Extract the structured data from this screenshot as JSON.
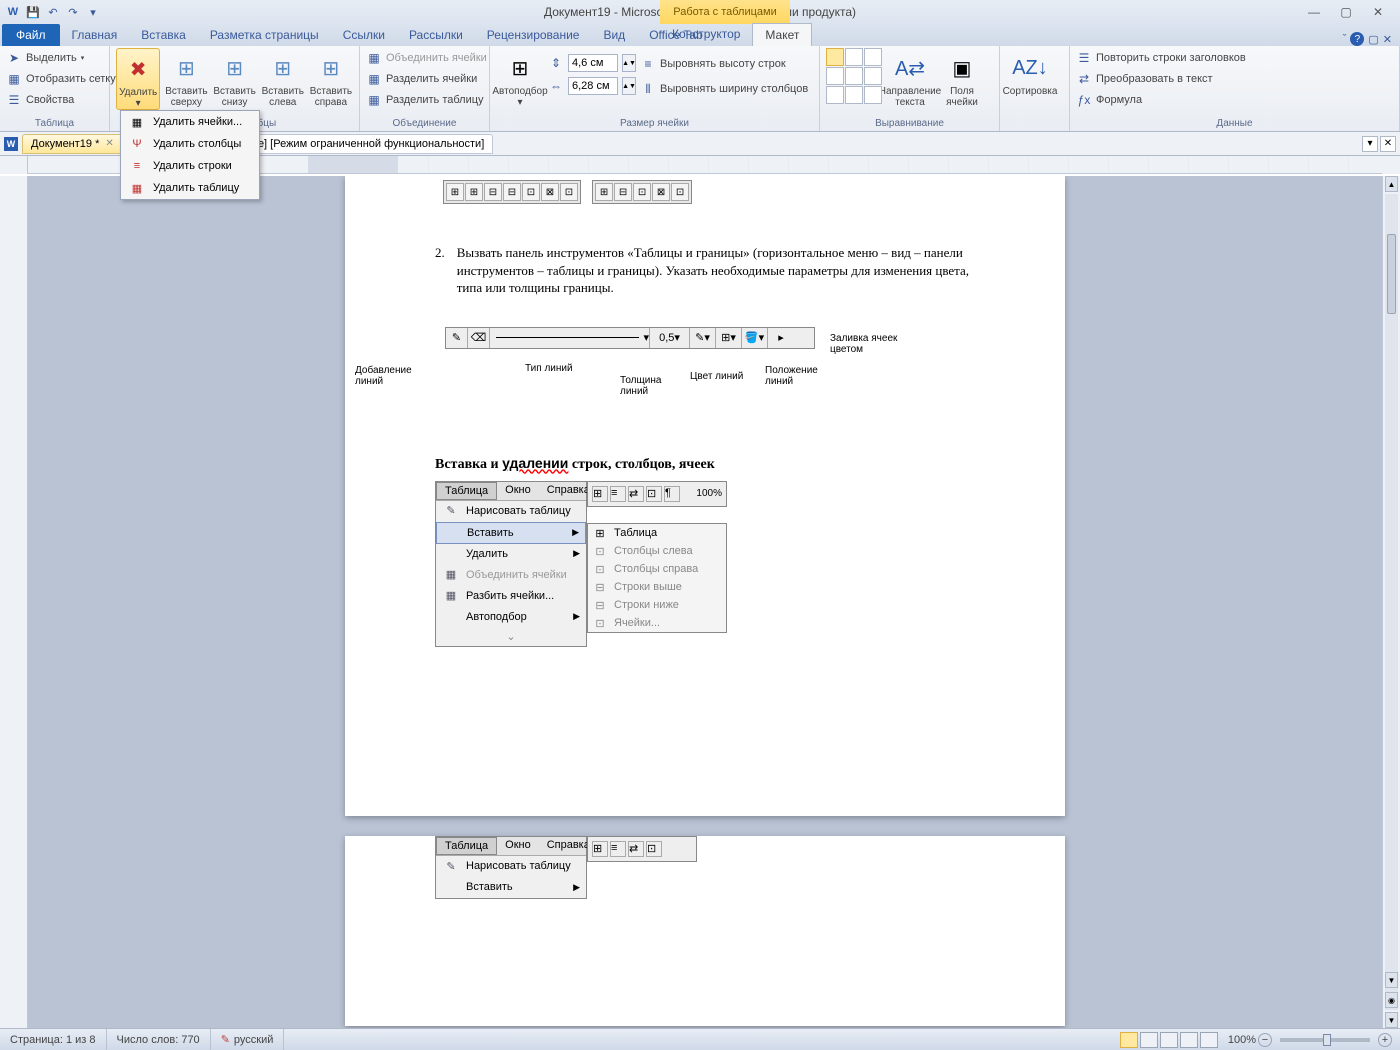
{
  "title": "Документ19 - Microsoft Word (Сбой активации продукта)",
  "tool_context_label": "Работа с таблицами",
  "ribbon_tabs": {
    "file": "Файл",
    "home": "Главная",
    "insert": "Вставка",
    "layout": "Разметка страницы",
    "references": "Ссылки",
    "mailings": "Рассылки",
    "review": "Рецензирование",
    "view": "Вид",
    "office_tab": "Office Tab",
    "design": "Конструктор",
    "table_layout": "Макет"
  },
  "ribbon": {
    "table_group": {
      "label": "Таблица",
      "select": "Выделить",
      "gridlines": "Отобразить сетку",
      "properties": "Свойства"
    },
    "rows_cols_group": {
      "label": "Строки и столбцы",
      "delete": "Удалить",
      "insert_above": "Вставить сверху",
      "insert_below": "Вставить снизу",
      "insert_left": "Вставить слева",
      "insert_right": "Вставить справа"
    },
    "merge_group": {
      "label": "Объединение",
      "merge_cells": "Объединить ячейки",
      "split_cells": "Разделить ячейки",
      "split_table": "Разделить таблицу"
    },
    "cell_size_group": {
      "label": "Размер ячейки",
      "autofit": "Автоподбор",
      "height": "4,6 см",
      "width": "6,28 см",
      "dist_rows": "Выровнять высоту строк",
      "dist_cols": "Выровнять ширину столбцов"
    },
    "alignment_group": {
      "label": "Выравнивание",
      "text_direction": "Направление текста",
      "cell_margins": "Поля ячейки"
    },
    "data_group": {
      "label": "Данные",
      "sort": "Сортировка",
      "repeat_header": "Повторить строки заголовков",
      "convert_text": "Преобразовать в текст",
      "formula": "Формула"
    }
  },
  "delete_menu": {
    "cells": "Удалить ячейки...",
    "columns": "Удалить столбцы",
    "rows": "Удалить строки",
    "table": "Удалить таблицу"
  },
  "doc_tabs": {
    "active": "Документ19 *",
    "second_suffix": "аботы.doc [только чтение] [Режим ограниченной функциональности]"
  },
  "document": {
    "item_number": "2.",
    "item_text": "Вызвать панель инструментов «Таблицы и границы» (горизонтальное меню – вид – панели инструментов – таблицы и границы). Указать необходимые параметры для изменения цвета, типа или толщины границы.",
    "diagram": {
      "line_width_value": "0,5",
      "label_add_lines": "Добавление линий",
      "label_line_type": "Тип линий",
      "label_line_thickness": "Толщина линий",
      "label_line_color": "Цвет линий",
      "label_line_position": "Положение линий",
      "label_fill": "Заливка ячеек цветом"
    },
    "heading": "Вставка и удалении строк, столбцов, ячеек",
    "old_menu": {
      "menubar": {
        "table": "Таблица",
        "window": "Окно",
        "help": "Справка"
      },
      "zoom": "100%",
      "draw_table": "Нарисовать таблицу",
      "insert": "Вставить",
      "delete": "Удалить",
      "merge": "Объединить ячейки",
      "split": "Разбить ячейки...",
      "autofit": "Автоподбор",
      "sub": {
        "table": "Таблица",
        "cols_left": "Столбцы слева",
        "cols_right": "Столбцы справа",
        "rows_above": "Строки выше",
        "rows_below": "Строки ниже",
        "cells": "Ячейки..."
      }
    }
  },
  "status": {
    "page": "Страница: 1 из 8",
    "words": "Число слов: 770",
    "language": "русский",
    "zoom": "100%"
  }
}
